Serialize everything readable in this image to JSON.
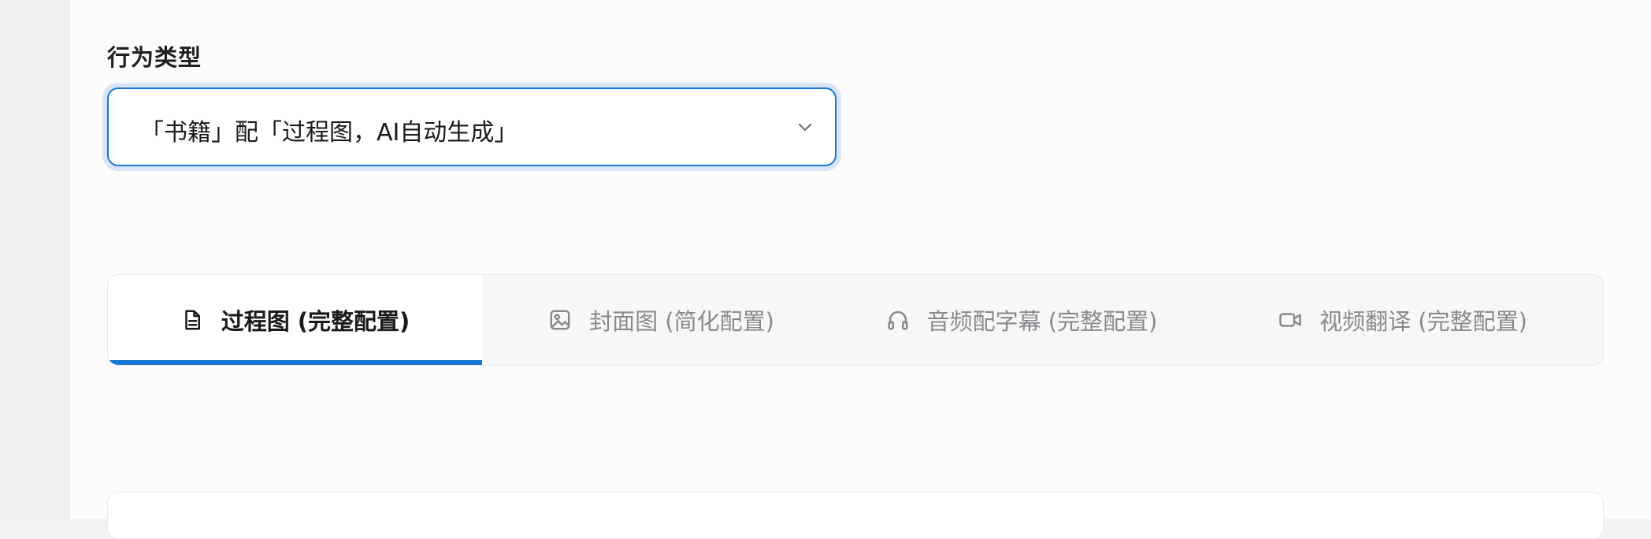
{
  "form": {
    "behavior_type_label": "行为类型",
    "behavior_type_value": "「书籍」配「过程图，AI自动生成」"
  },
  "tabs": [
    {
      "label": "过程图 (完整配置)",
      "icon": "document-icon",
      "active": true
    },
    {
      "label": "封面图 (简化配置)",
      "icon": "image-icon",
      "active": false
    },
    {
      "label": "音频配字幕 (完整配置)",
      "icon": "headphones-icon",
      "active": false
    },
    {
      "label": "视频翻译 (完整配置)",
      "icon": "video-camera-icon",
      "active": false
    }
  ],
  "colors": {
    "accent": "#1677d2",
    "active_text": "#1a1a1a",
    "inactive_text": "#8a8a8e"
  }
}
